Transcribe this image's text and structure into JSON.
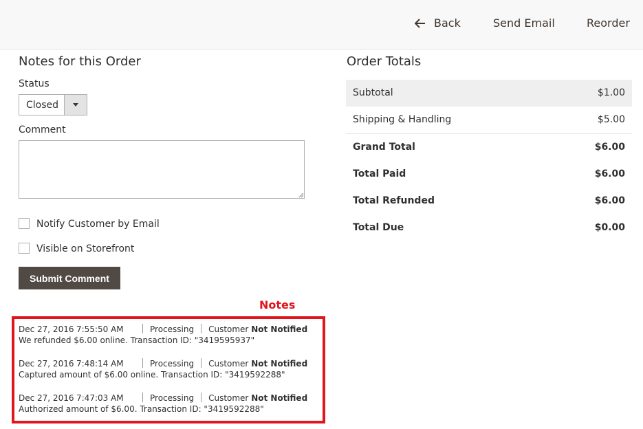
{
  "toolbar": {
    "back_label": "Back",
    "send_email_label": "Send Email",
    "reorder_label": "Reorder",
    "back_icon": "arrow-left-icon"
  },
  "notes_section": {
    "title": "Notes for this Order",
    "status_label": "Status",
    "status_value": "Closed",
    "comment_label": "Comment",
    "comment_value": "",
    "notify_label": "Notify Customer by Email",
    "notify_checked": false,
    "visible_label": "Visible on Storefront",
    "visible_checked": false,
    "submit_label": "Submit Comment"
  },
  "annotation": {
    "label": "Notes",
    "color": "#e0161e"
  },
  "notes": [
    {
      "date": "Dec 27, 2016",
      "time": "7:55:50 AM",
      "status": "Processing",
      "customer_prefix": "Customer",
      "notified": "Not Notified",
      "text": "We refunded $6.00 online. Transaction ID: \"3419595937\""
    },
    {
      "date": "Dec 27, 2016",
      "time": "7:48:14 AM",
      "status": "Processing",
      "customer_prefix": "Customer",
      "notified": "Not Notified",
      "text": "Captured amount of $6.00 online. Transaction ID: \"3419592288\""
    },
    {
      "date": "Dec 27, 2016",
      "time": "7:47:03 AM",
      "status": "Processing",
      "customer_prefix": "Customer",
      "notified": "Not Notified",
      "text": "Authorized amount of $6.00. Transaction ID: \"3419592288\""
    }
  ],
  "totals": {
    "title": "Order Totals",
    "rows": [
      {
        "label": "Subtotal",
        "amount": "$1.00"
      },
      {
        "label": "Shipping & Handling",
        "amount": "$5.00"
      },
      {
        "label": "Grand Total",
        "amount": "$6.00"
      },
      {
        "label": "Total Paid",
        "amount": "$6.00"
      },
      {
        "label": "Total Refunded",
        "amount": "$6.00"
      },
      {
        "label": "Total Due",
        "amount": "$0.00"
      }
    ]
  },
  "colors": {
    "button_dark": "#514943",
    "annotation_red": "#e0161e",
    "header_bg": "#f8f8f8"
  }
}
